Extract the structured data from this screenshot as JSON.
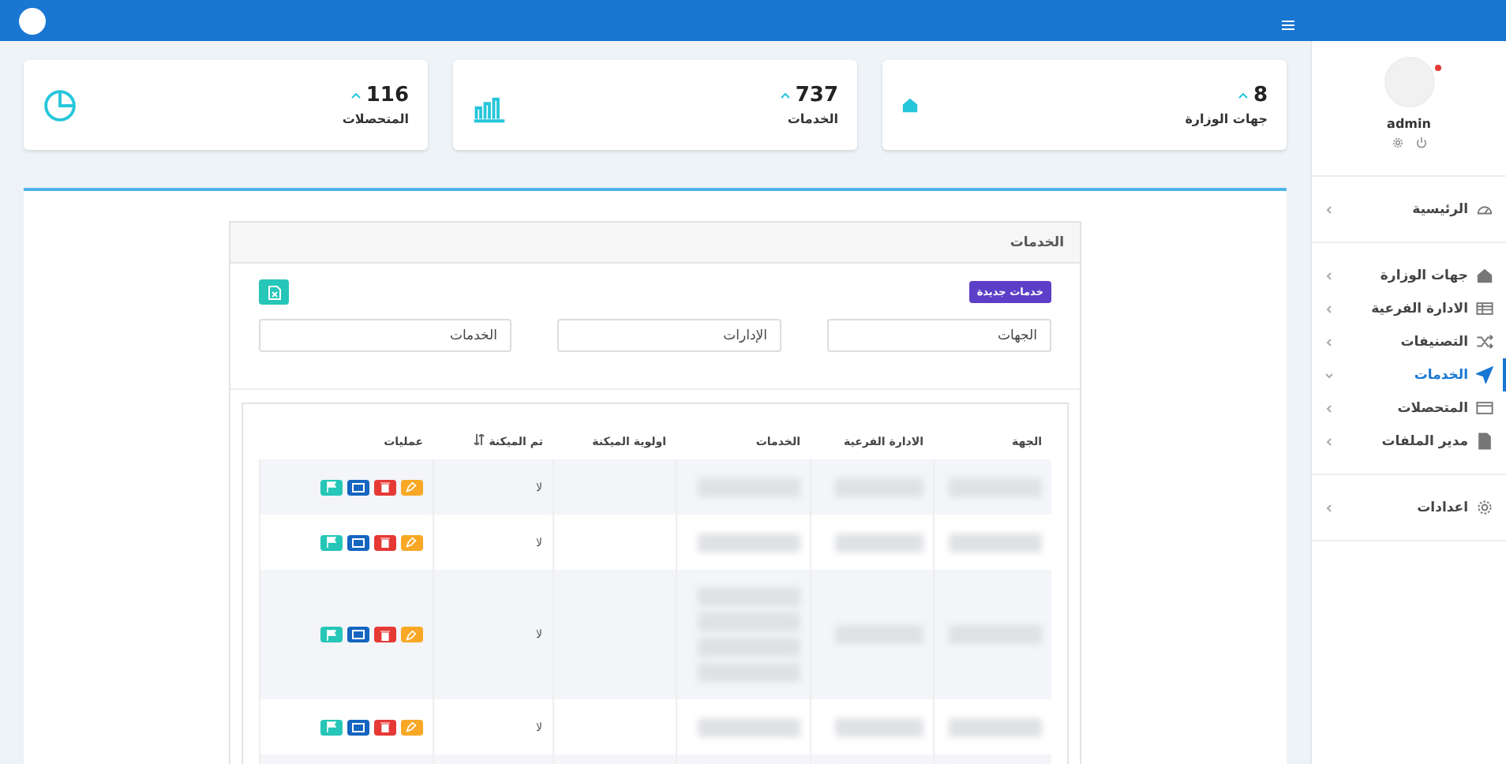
{
  "profile": {
    "name": "admin"
  },
  "sidebar": {
    "sections": [
      [
        {
          "label": "الرئيسية",
          "kind": "dashboard",
          "selected": false,
          "expanded": false
        }
      ],
      [
        {
          "label": "جهات الوزارة",
          "kind": "home",
          "selected": false,
          "expanded": false
        },
        {
          "label": "الادارة الفرعية",
          "kind": "list",
          "selected": false,
          "expanded": false
        },
        {
          "label": "التصنيفات",
          "kind": "shuffle",
          "selected": false,
          "expanded": false
        },
        {
          "label": "الخدمات",
          "kind": "send",
          "selected": true,
          "expanded": true
        },
        {
          "label": "المتحصلات",
          "kind": "card",
          "selected": false,
          "expanded": false
        },
        {
          "label": "مدير الملفات",
          "kind": "file",
          "selected": false,
          "expanded": false
        }
      ],
      [
        {
          "label": "اعدادات",
          "kind": "gear",
          "selected": false,
          "expanded": false
        }
      ]
    ]
  },
  "stats": [
    {
      "value": "8",
      "label": "جهات الوزارة",
      "kind": "home"
    },
    {
      "value": "737",
      "label": "الخدمات",
      "kind": "bars"
    },
    {
      "value": "116",
      "label": "المتحصلات",
      "kind": "pie"
    }
  ],
  "panel": {
    "title": "الخدمات",
    "new_button": "خدمات جديدة",
    "filters": [
      {
        "value": "الجهات"
      },
      {
        "value": "الإدارات"
      },
      {
        "value": "الخدمات"
      }
    ],
    "table": {
      "columns": [
        "الجهة",
        "الادارة الفرعية",
        "الخدمات",
        "اولوية الميكنة",
        "تم الميكنة",
        "عمليات"
      ],
      "rows": [
        {
          "kind": "single",
          "automated": "لا"
        },
        {
          "kind": "single",
          "automated": "لا"
        },
        {
          "kind": "multi",
          "automated": "لا"
        },
        {
          "kind": "single",
          "automated": "لا"
        },
        {
          "kind": "cut"
        }
      ]
    }
  }
}
